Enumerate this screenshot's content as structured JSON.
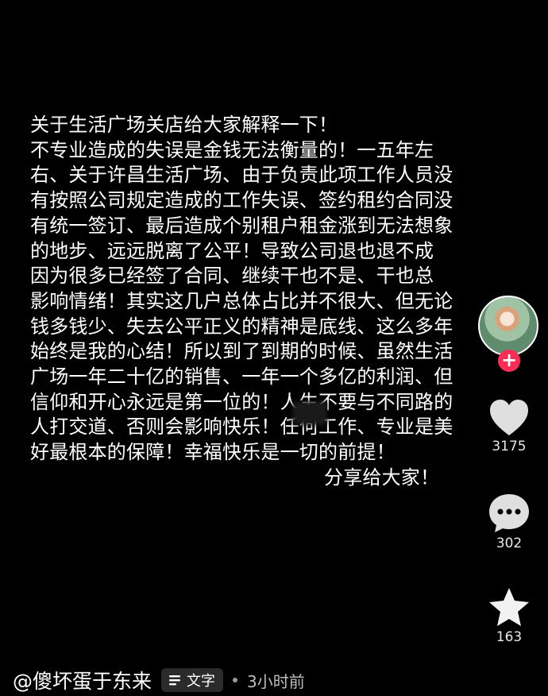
{
  "post": {
    "lines": [
      "关于生活广场关店给大家解释一下！",
      "不专业造成的失误是金钱无法衡量的！一五年左",
      "右、关于许昌生活广场、由于负责此项工作人员没",
      "有按照公司规定造成的工作失误、签约租约合同没",
      "有统一签订、最后造成个别租户租金涨到无法想象",
      "的地步、远远脱离了公平！导致公司退也退不成",
      "因为很多已经签了合同、继续干也不是、干也总",
      "影响情绪！其实这几户总体占比并不很大、但无论",
      "钱多钱少、失去公平正义的精神是底线、这么多年",
      "始终是我的心结！所以到了到期的时候、虽然生活",
      "广场一年二十亿的销售、一年一个多亿的利润、但",
      "信仰和开心永远是第一位的！人生不要与不同路的",
      "人打交道、否则会影响快乐！任何工作、专业是美",
      "好最根本的保障！幸福快乐是一切的前提！",
      "分享给大家！"
    ]
  },
  "rail": {
    "follow_symbol": "+",
    "like_count": "3175",
    "comment_count": "302",
    "favorite_count": "163",
    "like_icon": "heart-icon",
    "comment_icon": "comment-bubble-icon",
    "favorite_icon": "star-icon"
  },
  "author": {
    "name": "@傻坏蛋于东来",
    "tag_label": "文字",
    "timestamp": "3小时前"
  },
  "colors": {
    "background": "#000000",
    "text": "#ffffff",
    "follow_button": "#fe2c55",
    "tag_background": "#2b2b2b"
  }
}
